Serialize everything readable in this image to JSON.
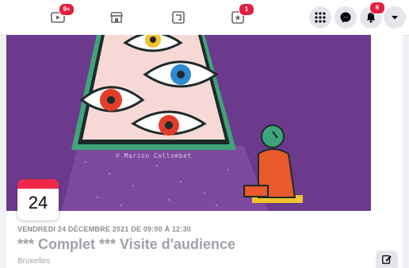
{
  "topbar": {
    "watch_badge": "9+",
    "pages_badge": "1",
    "notifications_badge": "6"
  },
  "cover": {
    "credit": "© Marion Collombet"
  },
  "event": {
    "day": "24",
    "date_time": "VENDREDI 24 DÉCEMBRE 2021 DE 09:00 À 12:30",
    "title": "*** Complet *** Visite d'audience",
    "location": "Bruxelles"
  },
  "colors": {
    "cover_background": "#6b3a8c",
    "badge": "#e41e3f",
    "date_strip": "#f02849"
  }
}
